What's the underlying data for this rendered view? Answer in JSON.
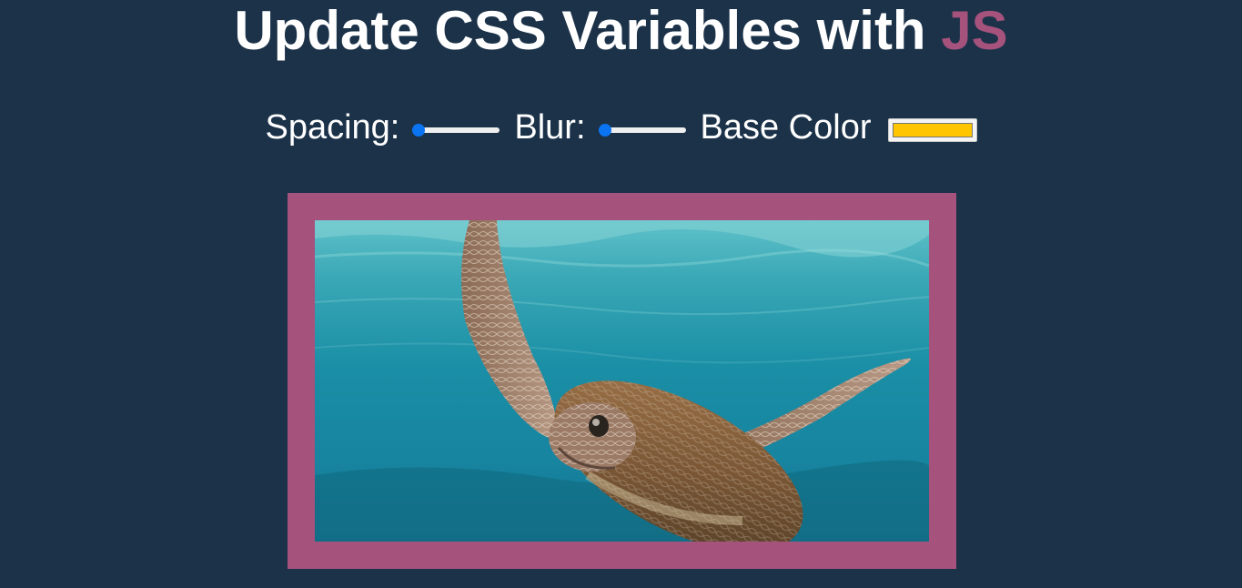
{
  "header": {
    "title_main": "Update CSS Variables with",
    "title_highlight": "JS"
  },
  "controls": {
    "spacing_label": "Spacing:",
    "blur_label": "Blur:",
    "base_color_label": "Base Color",
    "spacing_level": 0,
    "blur_level": 0,
    "base_color_value": "#ffc600"
  },
  "colors": {
    "background": "#1b3249",
    "accent": "#a5527d",
    "slider": "#0a74f2"
  },
  "image": {
    "subject": "sea-turtle-underwater-photo"
  }
}
